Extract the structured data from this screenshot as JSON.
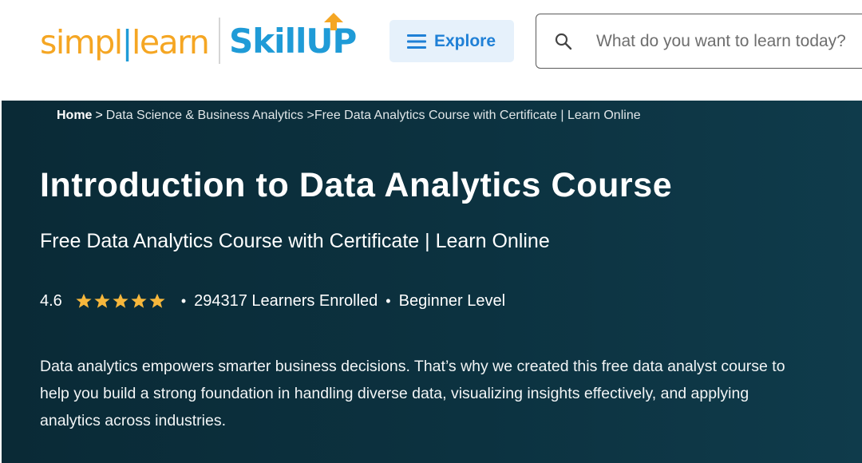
{
  "header": {
    "logo_simpli": "simpl",
    "logo_learn": "learn",
    "logo_skillup": "SkillUP",
    "explore_label": "Explore",
    "search_placeholder": "What do you want to learn today?"
  },
  "breadcrumb": {
    "home": "Home",
    "separator": ">",
    "category": "Data Science & Business Analytics",
    "current": ">Free Data Analytics Course with Certificate | Learn Online"
  },
  "course": {
    "title": "Introduction to Data Analytics Course",
    "subtitle": "Free Data Analytics Course with Certificate | Learn Online",
    "rating": "4.6",
    "stars": 5,
    "learners": "294317 Learners Enrolled",
    "level": "Beginner Level",
    "description": "Data analytics empowers smarter business decisions. That’s why we created this free data analyst course to help you build a strong foundation in handling diverse data, visualizing insights effectively, and applying analytics across industries."
  },
  "colors": {
    "brand_orange": "#f5a623",
    "brand_blue": "#1f9bd7",
    "explore_bg": "#e6f1fb",
    "hero_bg": "#0c3240",
    "star": "#f6b73c"
  }
}
